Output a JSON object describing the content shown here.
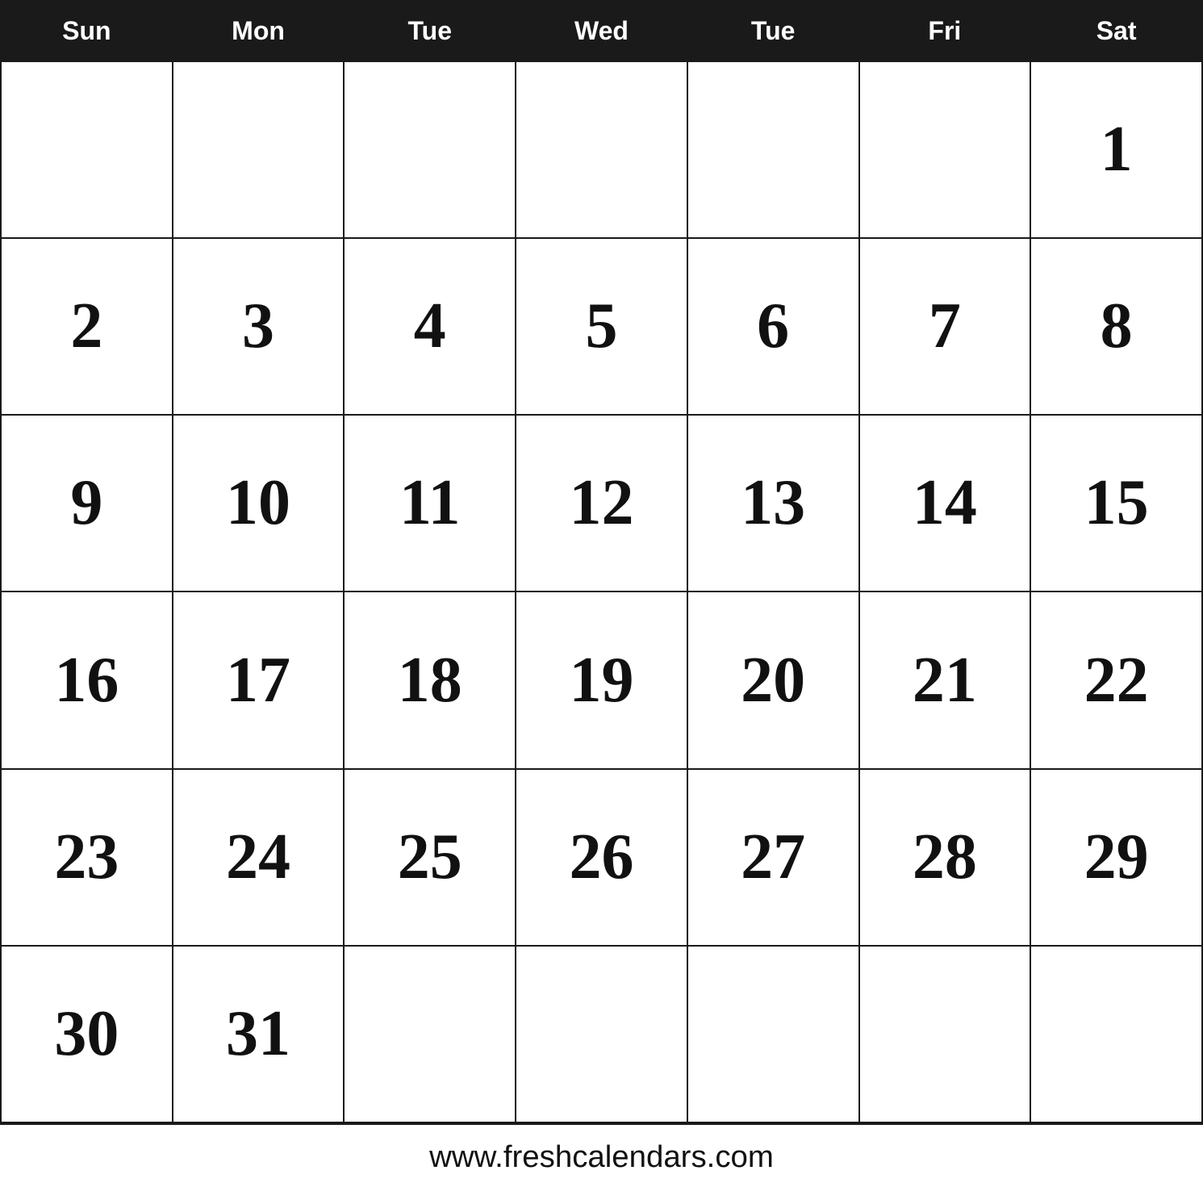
{
  "header": {
    "days": [
      {
        "label": "Sun"
      },
      {
        "label": "Mon"
      },
      {
        "label": "Tue"
      },
      {
        "label": "Wed"
      },
      {
        "label": "Tue"
      },
      {
        "label": "Fri"
      },
      {
        "label": "Sat"
      }
    ]
  },
  "weeks": [
    [
      "",
      "",
      "",
      "",
      "",
      "",
      "1"
    ],
    [
      "2",
      "3",
      "4",
      "5",
      "6",
      "7",
      "8"
    ],
    [
      "9",
      "10",
      "11",
      "12",
      "13",
      "14",
      "15"
    ],
    [
      "16",
      "17",
      "18",
      "19",
      "20",
      "21",
      "22"
    ],
    [
      "23",
      "24",
      "25",
      "26",
      "27",
      "28",
      "29"
    ],
    [
      "30",
      "31",
      "",
      "",
      "",
      "",
      ""
    ]
  ],
  "footer": {
    "text": "www.freshcalendars.com"
  }
}
